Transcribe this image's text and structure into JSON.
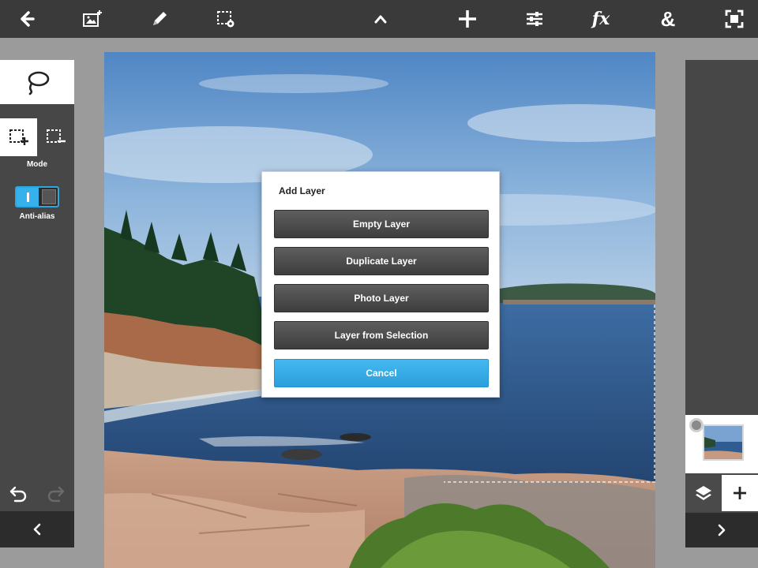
{
  "toolbar": {
    "icons": [
      "back-arrow-icon",
      "add-image-icon",
      "pencil-icon",
      "selection-settings-icon",
      "chevron-up-icon",
      "crosshair-plus-icon",
      "sliders-icon",
      "fx-icon",
      "ampersand-icon",
      "fullscreen-icon"
    ],
    "fx_label": "fx",
    "amp_label": "&"
  },
  "left_panel": {
    "mode_label": "Mode",
    "antialias_label": "Anti-alias",
    "antialias_on": true
  },
  "dialog": {
    "title": "Add Layer",
    "buttons": {
      "empty": "Empty Layer",
      "duplicate": "Duplicate Layer",
      "photo": "Photo Layer",
      "from_selection": "Layer from Selection",
      "cancel": "Cancel"
    }
  },
  "colors": {
    "toolbar_bg": "#3a3a3a",
    "panel_bg": "#474747",
    "accent_blue": "#35b1ec",
    "dark_button": "#4a4a4a"
  }
}
